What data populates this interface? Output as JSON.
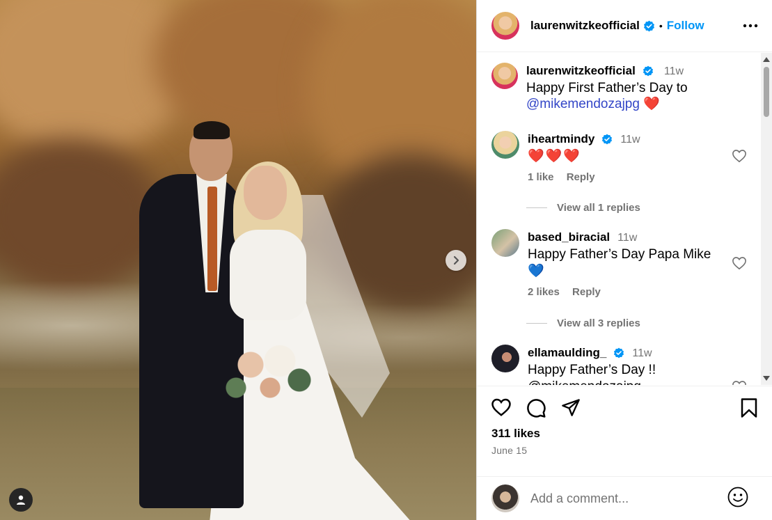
{
  "post": {
    "author": "laurenwitzkeofficial",
    "follow_label": "Follow",
    "separator": "•",
    "caption_time": "11w",
    "caption_text": "Happy First Father’s Day to",
    "caption_mention": "@mikemendozajpg",
    "caption_emoji": "❤️",
    "likes": "311 likes",
    "date": "June 15"
  },
  "comments": [
    {
      "username": "iheartmindy",
      "verified": true,
      "time": "11w",
      "text": "❤️❤️❤️",
      "likes": "1 like",
      "reply": "Reply",
      "view_replies": "View all 1 replies"
    },
    {
      "username": "based_biracial",
      "verified": false,
      "time": "11w",
      "text": "Happy Father’s Day Papa Mike",
      "text2": "💙",
      "likes": "2 likes",
      "reply": "Reply",
      "view_replies": "View all 3 replies"
    },
    {
      "username": "ellamaulding_",
      "verified": true,
      "time": "11w",
      "text": "Happy Father’s Day !!",
      "text2": "@mikemendozajpg"
    }
  ],
  "composer": {
    "placeholder": "Add a comment..."
  },
  "colors": {
    "accent": "#0095f6",
    "verified": "#0095f6",
    "heart": "#ed4956",
    "mention": "#3346c7"
  },
  "icons": [
    "chevron-right-icon",
    "user-tag-icon",
    "verified-icon",
    "more-icon",
    "heart-icon",
    "comment-icon",
    "share-icon",
    "bookmark-icon",
    "emoji-icon"
  ]
}
